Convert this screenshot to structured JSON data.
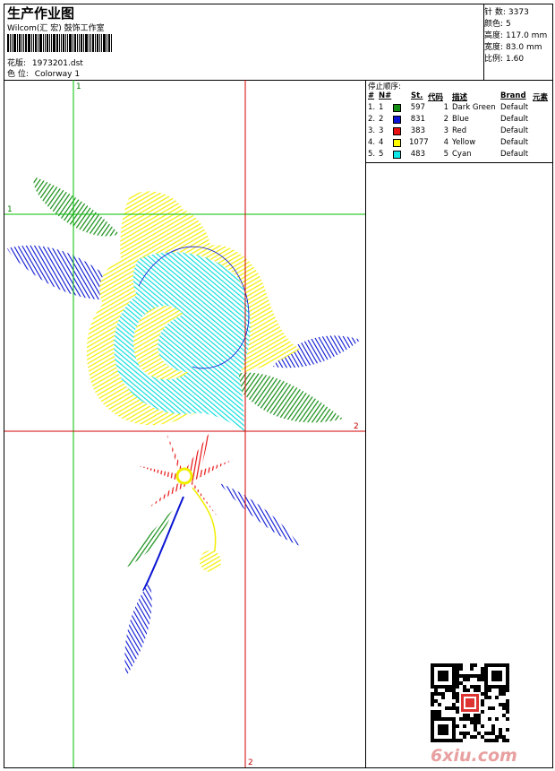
{
  "header": {
    "title": "生产作业图",
    "subtitle": "Wilcom(汇 宏) 鼓饰工作室",
    "file_label": "花版:",
    "file_value": "1973201.dst",
    "colorway_label": "色 位:",
    "colorway_value": "Colorway 1"
  },
  "stats": [
    {
      "label": "针 数:",
      "value": "3373"
    },
    {
      "label": "颜色:",
      "value": "5"
    },
    {
      "label": "高度:",
      "value": "117.0 mm"
    },
    {
      "label": "宽度:",
      "value": "83.0 mm"
    },
    {
      "label": "比例:",
      "value": "1.60"
    }
  ],
  "stop_sequence": {
    "title": "停止顺序:",
    "headers": {
      "num": "#",
      "n": "N#",
      "st": "St.",
      "code": "代码",
      "desc": "描述",
      "brand": "Brand",
      "elem": "元素"
    },
    "rows": [
      {
        "num": "1.",
        "n": "1",
        "color": "#128c12",
        "st": "597",
        "code": "1",
        "desc": "Dark Green",
        "brand": "Default"
      },
      {
        "num": "2.",
        "n": "2",
        "color": "#0a14d2",
        "st": "831",
        "code": "2",
        "desc": "Blue",
        "brand": "Default"
      },
      {
        "num": "3.",
        "n": "3",
        "color": "#e81010",
        "st": "383",
        "code": "3",
        "desc": "Red",
        "brand": "Default"
      },
      {
        "num": "4.",
        "n": "4",
        "color": "#ffff00",
        "st": "1077",
        "code": "4",
        "desc": "Yellow",
        "brand": "Default"
      },
      {
        "num": "5.",
        "n": "5",
        "color": "#10e8e8",
        "st": "483",
        "code": "5",
        "desc": "Cyan",
        "brand": "Default"
      }
    ]
  },
  "guides": {
    "green_top": "1",
    "green_left": "1",
    "red_right": "2",
    "red_bottom": "2"
  },
  "watermark": "6xiu.com"
}
